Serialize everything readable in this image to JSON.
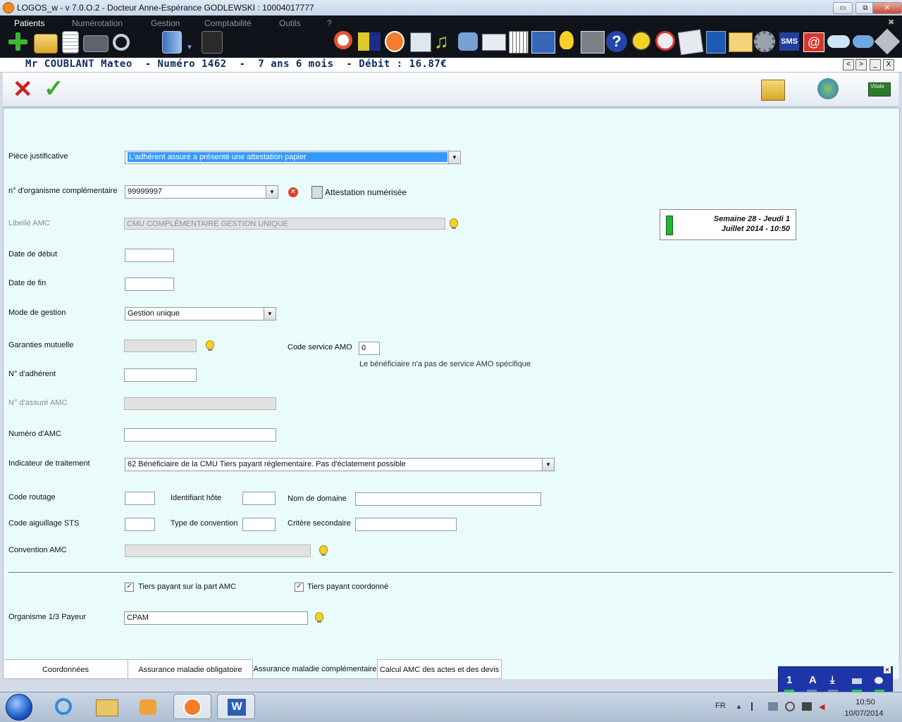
{
  "window": {
    "title": "LOGOS_w - v 7.0.O.2  -  Docteur Anne-Espérance GODLEWSKI : 10004017777",
    "controls": {
      "minimize": "▭",
      "maximize": "⧉",
      "close": "✕"
    }
  },
  "menu": {
    "items": [
      "Patients",
      "Numérotation",
      "Gestion",
      "Comptabilité",
      "Outils",
      "?"
    ]
  },
  "toolbar_right": {
    "sms_label": "SMS"
  },
  "patient": {
    "header": "Mr COUBLANT Mateo  - Numéro 1462  -  7 ans 6 mois  - Débit : 16.87€",
    "nav": [
      "<",
      ">",
      "_",
      "X"
    ]
  },
  "actions": {
    "cancel": "✕",
    "confirm": "✓",
    "vitale_label": "Vitale"
  },
  "form": {
    "piece_justificative": {
      "label": "Pièce justificative",
      "value": "L'adhérent assuré a présenté une attestation papier"
    },
    "organisme_complementaire": {
      "label": "n° d'organisme complémentaire",
      "value": "99999997",
      "attestation_label": "Attestation numérisée"
    },
    "libelle_amc": {
      "label": "Libellé AMC",
      "value": "CMU COMPLÉMENTAIRE GESTION UNIQUE"
    },
    "date_debut": {
      "label": "Date de début",
      "value": ""
    },
    "date_fin": {
      "label": "Date de fin",
      "value": ""
    },
    "mode_gestion": {
      "label": "Mode de gestion",
      "value": "Gestion unique"
    },
    "garanties_mutuelle": {
      "label": "Garanties mutuelle",
      "value": ""
    },
    "code_service_amo": {
      "label": "Code service AMO",
      "value": "0",
      "note": "Le bénéficiaire n'a pas de service AMO spécifique"
    },
    "numero_adherent": {
      "label": "N° d'adhérent",
      "value": ""
    },
    "numero_assure_amc": {
      "label": "N° d'assuré AMC",
      "value": ""
    },
    "numero_amc": {
      "label": "Numéro d'AMC",
      "value": ""
    },
    "indicateur_traitement": {
      "label": "Indicateur de traitement",
      "value": "62 Bénéficiaire de la CMU Tiers payant réglementaire. Pas d'éclatement possible"
    },
    "code_routage": {
      "label": "Code routage",
      "value": ""
    },
    "identifiant_hote": {
      "label": "Identifiant hôte",
      "value": ""
    },
    "nom_domaine": {
      "label": "Nom de domaine",
      "value": ""
    },
    "code_aiguillage": {
      "label": "Code aiguillage STS",
      "value": ""
    },
    "type_convention": {
      "label": "Type de convention",
      "value": ""
    },
    "critere_secondaire": {
      "label": "Critère secondaire",
      "value": ""
    },
    "convention_amc": {
      "label": "Convention AMC",
      "value": ""
    },
    "tiers_payant_amc": {
      "label": "Tiers payant sur la part AMC",
      "checked": true
    },
    "tiers_payant_coordonne": {
      "label": "Tiers payant coordonné",
      "checked": true
    },
    "organisme_payeur": {
      "label": "Organisme 1/3 Payeur",
      "value": "CPAM"
    }
  },
  "week_widget": {
    "line1": "Semaine 28 - Jeudi 1",
    "line2": "Juillet 2014 - 10:50"
  },
  "tabs": [
    {
      "label": "Coordonnées",
      "active": false
    },
    {
      "label": "Assurance maladie obligatoire",
      "active": false
    },
    {
      "label": "Assurance maladie complémentaire",
      "active": true
    },
    {
      "label": "Calcul AMC des actes et des devis",
      "active": false
    }
  ],
  "blue_panel": {
    "items": [
      "1",
      "A",
      "⤓"
    ]
  },
  "taskbar": {
    "language": "FR",
    "time": "10:50",
    "date": "10/07/2014"
  },
  "colors": {
    "form_background": "#e9fbfb",
    "patient_header_text": "#0b2a66",
    "cancel": "#d11c1c",
    "confirm": "#3eaa29"
  }
}
